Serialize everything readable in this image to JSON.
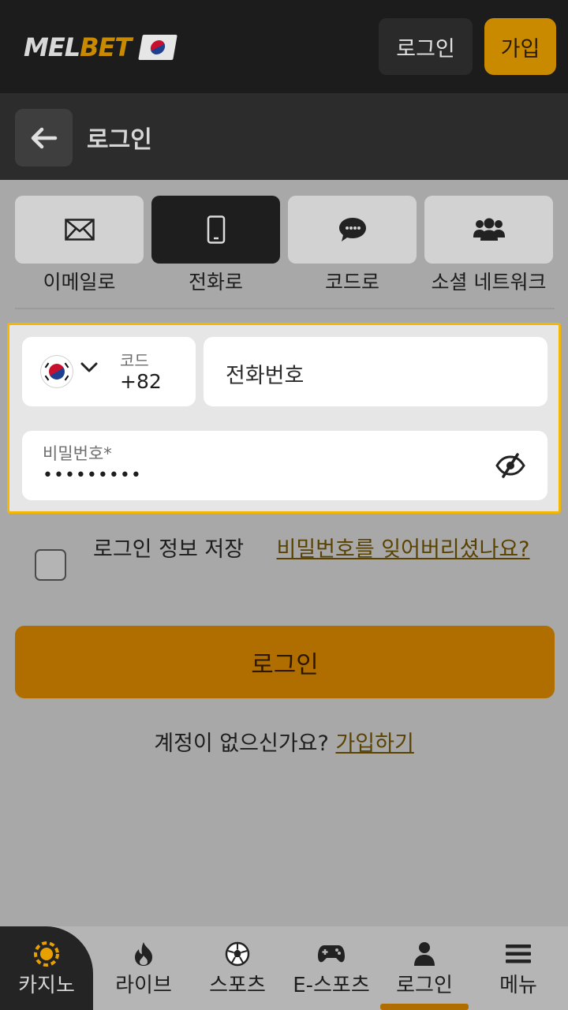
{
  "header": {
    "logo_left": "MEL",
    "logo_right": "BET",
    "login_label": "로그인",
    "signup_label": "가입"
  },
  "subheader": {
    "title": "로그인"
  },
  "methods": [
    {
      "label": "이메일로",
      "icon": "envelope-icon",
      "active": false
    },
    {
      "label": "전화로",
      "icon": "phone-icon",
      "active": true
    },
    {
      "label": "코드로",
      "icon": "chat-icon",
      "active": false
    },
    {
      "label": "소셜 네트워크",
      "icon": "users-icon",
      "active": false
    }
  ],
  "form": {
    "code_label": "코드",
    "code_value": "+82",
    "phone_placeholder": "전화번호",
    "password_label": "비밀번호*",
    "password_value": "•••••••••"
  },
  "remember_label": "로그인 정보 저장",
  "forgot_label": "비밀번호를 잊어버리셨나요?",
  "login_button": "로그인",
  "signup_prompt": "계정이 없으신가요? ",
  "signup_link": "가입하기",
  "bottom_nav": [
    {
      "label": "카지노",
      "icon": "casino-chip-icon"
    },
    {
      "label": "라이브",
      "icon": "flame-icon"
    },
    {
      "label": "스포츠",
      "icon": "soccer-ball-icon"
    },
    {
      "label": "E-스포츠",
      "icon": "gamepad-icon"
    },
    {
      "label": "로그인",
      "icon": "user-icon",
      "active": true
    },
    {
      "label": "메뉴",
      "icon": "hamburger-icon"
    }
  ],
  "colors": {
    "accent": "#c98a00",
    "highlight": "#f2b705",
    "header": "#1c1c1c"
  }
}
